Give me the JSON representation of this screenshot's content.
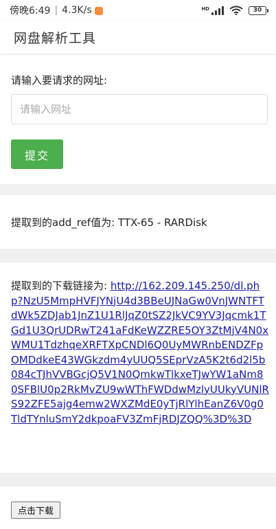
{
  "status_bar": {
    "time": "傍晚6:49",
    "speed": "4.3K/s",
    "network": "HD",
    "battery": "30"
  },
  "header": {
    "title": "网盘解析工具"
  },
  "request": {
    "label": "请输入要请求的网址:",
    "input_value": "",
    "input_placeholder": "请输入网址",
    "submit_label": "提交"
  },
  "addref": {
    "label": "提取到的add_ref值为:",
    "value": "TTX-65 - RARDisk"
  },
  "download": {
    "label": "提取到的下载链接为:",
    "url": "http://162.209.145.250/dl.php?NzU5MmpHVFJYNjU4d3BBeUJNaGw0VnJWNTFTdWk5ZDJab1JnZ1U1RlJqZ0tSZ2JkVC9YV3Jqcmk1TGd1U3QrUDRwT241aFdKeWZZRE5OY3ZtMjV4N0xWMU1TdzhqeXRFTXpCNDl6Q0UyMWRnbENDZFpOMDdkeE43WGkzdm4yUUQ5SEprVzA5K2t6d2l5b084cTJhVVBGcjQ5V1N0QmkwTlkxeTJwYW1aNm80SFBlU0p2RkMvZU9wWThFWDdwMzlyUUkyVUNlRS92ZFE5ajg4emw2WXZMdE0yTjRlYlhEanZ6V0g0TldTYnluSmY2dkpoaFV3ZmFjRDJZQQ%3D%3D",
    "button_label": "点击下载"
  }
}
